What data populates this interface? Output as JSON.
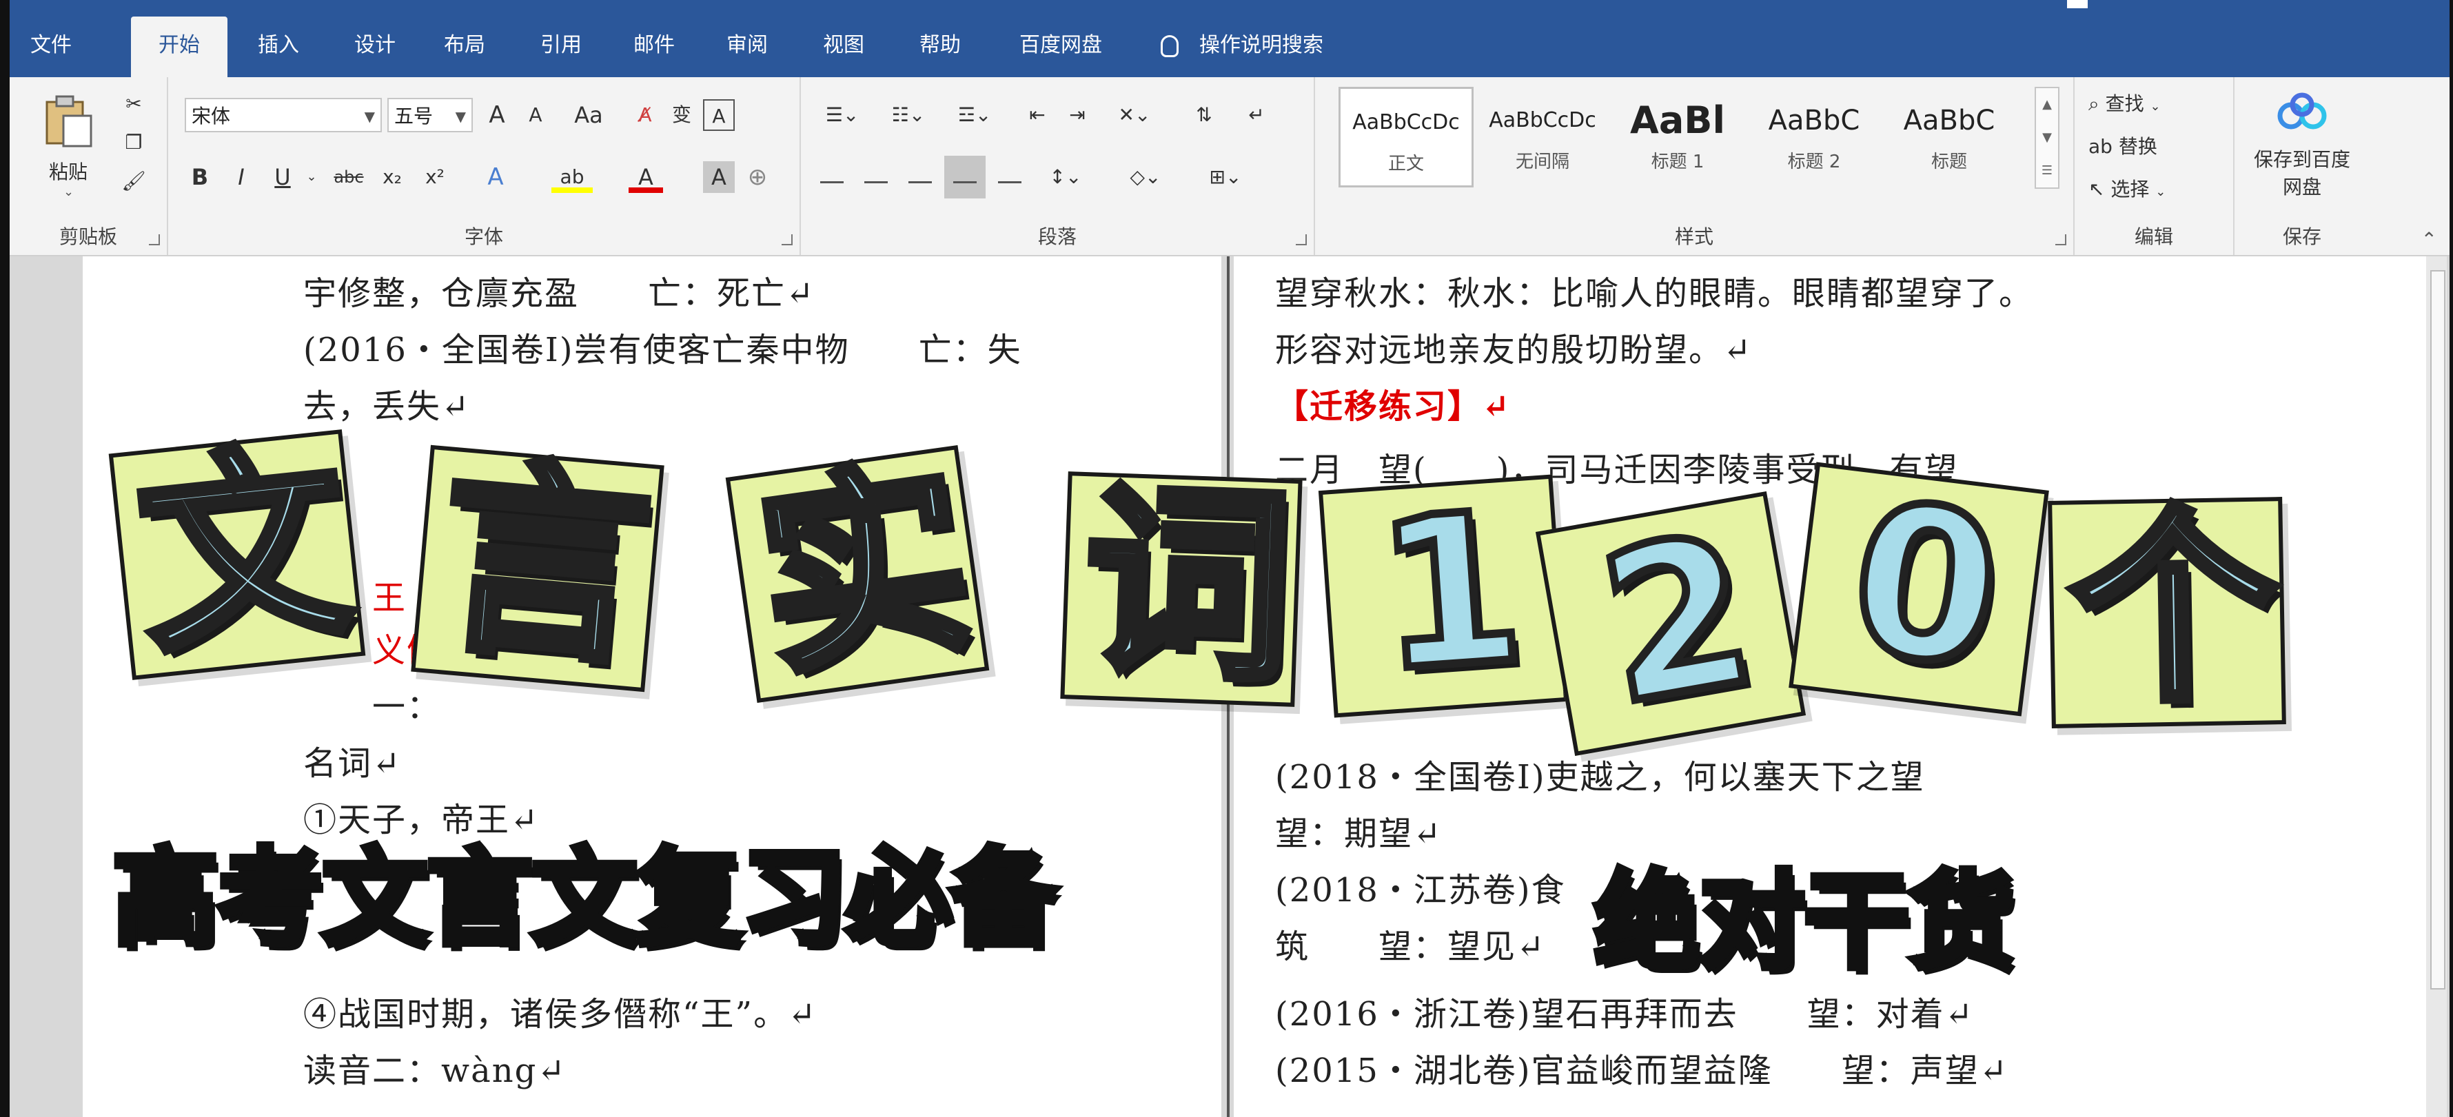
{
  "tabs": [
    {
      "label": "文件",
      "active": false
    },
    {
      "label": "开始",
      "active": true
    },
    {
      "label": "插入",
      "active": false
    },
    {
      "label": "设计",
      "active": false
    },
    {
      "label": "布局",
      "active": false
    },
    {
      "label": "引用",
      "active": false
    },
    {
      "label": "邮件",
      "active": false
    },
    {
      "label": "审阅",
      "active": false
    },
    {
      "label": "视图",
      "active": false
    },
    {
      "label": "帮助",
      "active": false
    },
    {
      "label": "百度网盘",
      "active": false
    }
  ],
  "tell_me": "操作说明搜索",
  "ribbon": {
    "clipboard": {
      "paste_label": "粘贴",
      "group_label": "剪贴板"
    },
    "font": {
      "font_name": "宋体",
      "font_size": "五号",
      "grow": "A",
      "shrink": "A",
      "change_case": "Aa",
      "wen": "变",
      "border_a": "A",
      "bold": "B",
      "italic": "I",
      "underline": "U",
      "strike": "abc",
      "subscript": "x₂",
      "superscript": "x²",
      "text_effect": "A",
      "font_color": "A",
      "shade_a": "A",
      "group_label": "字体"
    },
    "paragraph": {
      "group_label": "段落"
    },
    "styles": {
      "items": [
        {
          "preview": "AaBbCcDc",
          "name": "正文",
          "selected": true
        },
        {
          "preview": "AaBbCcDc",
          "name": "无间隔",
          "selected": false
        },
        {
          "preview": "AaBl",
          "name": "标题 1",
          "selected": false
        },
        {
          "preview": "AaBbC",
          "name": "标题 2",
          "selected": false
        },
        {
          "preview": "AaBbC",
          "name": "标题",
          "selected": false
        }
      ],
      "group_label": "样式"
    },
    "editing": {
      "find": "查找",
      "replace": "替换",
      "select": "选择",
      "group_label": "编辑"
    },
    "save": {
      "button_label": "保存到百度网盘",
      "group_label": "保存"
    }
  },
  "document": {
    "left_lines": [
      {
        "text": "宇修整，仓廪充盈　　亡：死亡↵",
        "red": false
      },
      {
        "text": "(2016・全国卷Ⅰ)尝有使客亡秦中物　　亡：失",
        "red": false
      },
      {
        "text": "去，丢失↵",
        "red": false
      },
      {
        "text": "王",
        "red": true
      },
      {
        "text": "义例",
        "red": true
      },
      {
        "text": "一：",
        "red": false
      },
      {
        "text": "名词↵",
        "red": false
      },
      {
        "text": "①天子，帝王↵",
        "red": false
      },
      {
        "text": "④战国时期，诸侯多僭称“王”。↵",
        "red": false
      },
      {
        "text": "读音二：wàng↵",
        "red": false
      }
    ],
    "right_lines": [
      {
        "text": "望穿秋水：秋水：比喻人的眼睛。眼睛都望穿了。",
        "red": false
      },
      {
        "text": "形容对远地亲友的殷切盼望。↵",
        "red": false
      },
      {
        "text": "【迁移练习】↵",
        "red": true
      },
      {
        "text": "二月　望(　　)，司马迁因李陵事受刑，有望",
        "red": false
      },
      {
        "text": "(2018・全国卷Ⅰ)吏越之，何以塞天下之望",
        "red": false
      },
      {
        "text": "望：期望↵",
        "red": false
      },
      {
        "text": "(2018・江苏卷)食",
        "red": false
      },
      {
        "text": "筑　　望：望见↵",
        "red": false
      },
      {
        "text": "(2016・浙江卷)望石再拜而去　　望：对着↵",
        "red": false
      },
      {
        "text": "(2015・湖北卷)官益峻而望益隆　　望：声望↵",
        "red": false
      }
    ]
  },
  "overlay": {
    "title_chars": [
      "文",
      "言",
      "实",
      "词",
      "1",
      "2",
      "0",
      "个"
    ],
    "subtitle_left": "高考文言文复习必备",
    "subtitle_right": "绝对干货",
    "tile_color": "#e6f3a4",
    "char_color": "#a8dcea"
  },
  "colors": {
    "accent": "#2b579a",
    "ribbon_bg": "#f3f3f3",
    "red_text": "#e00000"
  }
}
